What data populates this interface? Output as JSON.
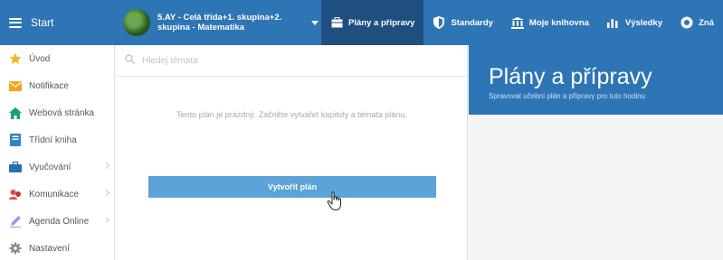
{
  "topbar": {
    "start_label": "Start",
    "class_selector": "5.AY - Celá třída+1. skupina+2. skupina - Matematika",
    "nav": [
      {
        "label": "Plány a přípravy",
        "icon": "folder-icon",
        "active": true
      },
      {
        "label": "Standardy",
        "icon": "shield-icon",
        "active": false
      },
      {
        "label": "Moje knihovna",
        "icon": "library-icon",
        "active": false
      },
      {
        "label": "Výsledky",
        "icon": "bar-chart-icon",
        "active": false
      },
      {
        "label": "Zná",
        "icon": "globe-icon",
        "active": false
      }
    ]
  },
  "sidebar": {
    "items": [
      {
        "label": "Úvod",
        "icon": "star-icon",
        "has_arrow": false
      },
      {
        "label": "Notifikace",
        "icon": "mail-icon",
        "has_arrow": false
      },
      {
        "label": "Webová stránka",
        "icon": "home-icon",
        "has_arrow": false
      },
      {
        "label": "Třídní kniha",
        "icon": "book-icon",
        "has_arrow": false
      },
      {
        "label": "Vyučování",
        "icon": "briefcase-icon",
        "has_arrow": true
      },
      {
        "label": "Komunikace",
        "icon": "people-icon",
        "has_arrow": true
      },
      {
        "label": "Agenda Online",
        "icon": "pen-icon",
        "has_arrow": true
      },
      {
        "label": "Nastavení",
        "icon": "gear-icon",
        "has_arrow": false
      }
    ]
  },
  "main": {
    "search_placeholder": "Hledej témata",
    "empty_message": "Tento plán je prázdný. Začněte vytvářet kapitoly a témata plánu.",
    "create_button": "Vytvořit plán"
  },
  "right": {
    "title": "Plány a přípravy",
    "subtitle": "Spravovat učební plán a přípravy pro tuto hodinu"
  },
  "colors": {
    "topbar": "#2e75b6",
    "active_nav": "#1e4f80",
    "button": "#5ba3d9"
  }
}
